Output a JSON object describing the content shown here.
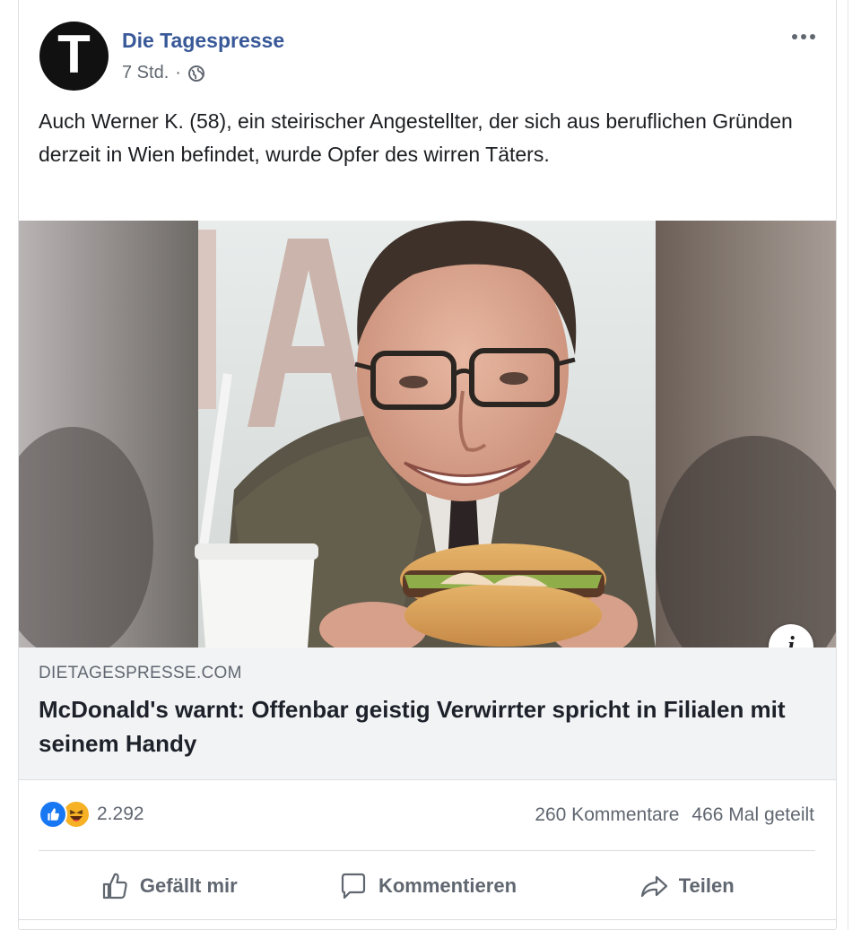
{
  "post": {
    "page_name": "Die Tagespresse",
    "avatar_letter": "T",
    "timestamp": "7 Std.",
    "separator": "·",
    "visibility_icon": "globe-icon",
    "more_icon": "more-options-icon",
    "text": "Auch Werner K. (58), ein steirischer Angestellter, der sich aus beruflichen Gründen derzeit in Wien befindet, wurde Opfer des wirren Täters."
  },
  "link_preview": {
    "domain": "DIETAGESPRESSE.COM",
    "title": "McDonald's warnt: Offenbar geistig Verwirrter spricht in Filialen mit seinem Handy",
    "info_icon": "i"
  },
  "engagement": {
    "reaction_icons": [
      "like-reaction-icon",
      "haha-reaction-icon"
    ],
    "reaction_count": "2.292",
    "comments": "260 Kommentare",
    "shares": "466 Mal geteilt"
  },
  "actions": {
    "like_label": "Gefällt mir",
    "comment_label": "Kommentieren",
    "share_label": "Teilen"
  },
  "colors": {
    "page_name": "#385898",
    "like_blue": "#1877f2",
    "haha_yellow": "#f7b125",
    "link_box_bg": "#f2f3f5"
  }
}
